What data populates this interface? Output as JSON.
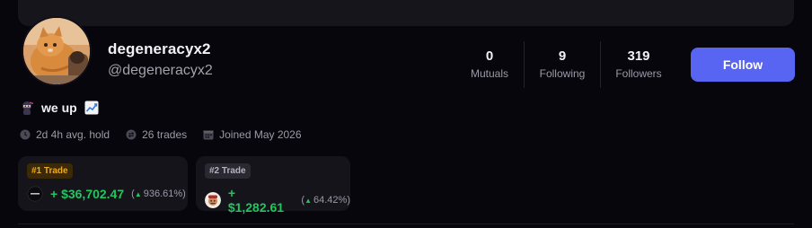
{
  "profile": {
    "display_name": "degeneracyx2",
    "handle": "@degeneracyx2",
    "bio_text": "we up",
    "avatar_icon": "orange-cat-avatar"
  },
  "stats": [
    {
      "value": "0",
      "label": "Mutuals"
    },
    {
      "value": "9",
      "label": "Following"
    },
    {
      "value": "319",
      "label": "Followers"
    }
  ],
  "follow_button": {
    "label": "Follow",
    "color": "#5865f2"
  },
  "meta": {
    "hold": "2d 4h avg. hold",
    "trades": "26 trades",
    "joined": "Joined May 2026"
  },
  "trades": [
    {
      "rank": "#1 Trade",
      "gain": "+ $36,702.47",
      "pct": "936.61%",
      "token_icon": "dark-token-icon"
    },
    {
      "rank": "#2 Trade",
      "gain": "+ $1,282.61",
      "pct": "64.42%",
      "token_icon": "character-token-icon"
    }
  ],
  "colors": {
    "background": "#07060c",
    "accent": "#5865f2",
    "positive": "#22c55e",
    "gold": "#f0a81c"
  }
}
